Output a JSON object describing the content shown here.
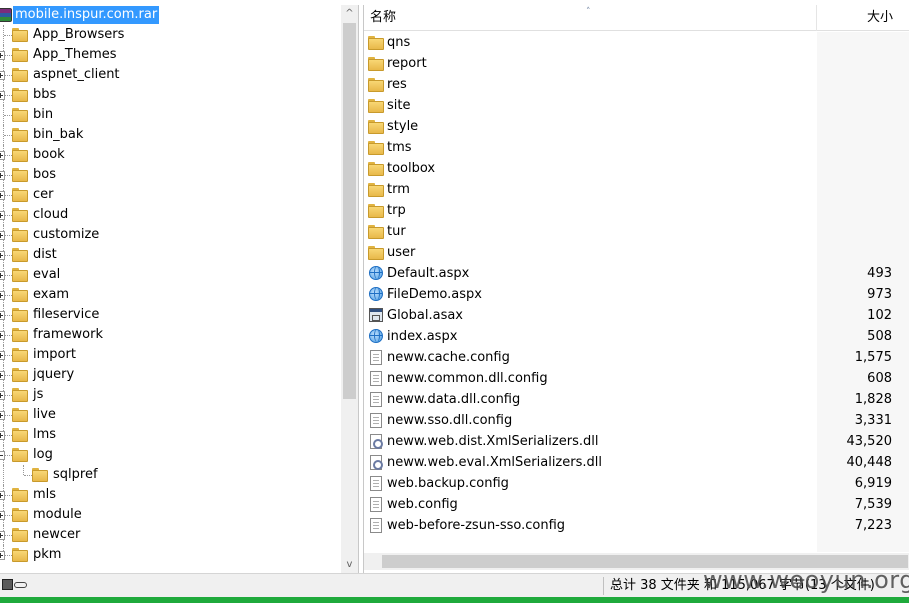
{
  "tree": {
    "root_label": "mobile.inspur.com.rar",
    "items": [
      {
        "label": "App_Browsers",
        "expander": "none",
        "depth": 1
      },
      {
        "label": "App_Themes",
        "expander": "plus",
        "depth": 1
      },
      {
        "label": "aspnet_client",
        "expander": "plus",
        "depth": 1
      },
      {
        "label": "bbs",
        "expander": "plus",
        "depth": 1
      },
      {
        "label": "bin",
        "expander": "none",
        "depth": 1
      },
      {
        "label": "bin_bak",
        "expander": "none",
        "depth": 1
      },
      {
        "label": "book",
        "expander": "plus",
        "depth": 1
      },
      {
        "label": "bos",
        "expander": "plus",
        "depth": 1
      },
      {
        "label": "cer",
        "expander": "plus",
        "depth": 1
      },
      {
        "label": "cloud",
        "expander": "plus",
        "depth": 1
      },
      {
        "label": "customize",
        "expander": "plus",
        "depth": 1
      },
      {
        "label": "dist",
        "expander": "plus",
        "depth": 1
      },
      {
        "label": "eval",
        "expander": "plus",
        "depth": 1
      },
      {
        "label": "exam",
        "expander": "plus",
        "depth": 1
      },
      {
        "label": "fileservice",
        "expander": "plus",
        "depth": 1
      },
      {
        "label": "framework",
        "expander": "plus",
        "depth": 1
      },
      {
        "label": "import",
        "expander": "plus",
        "depth": 1
      },
      {
        "label": "jquery",
        "expander": "plus",
        "depth": 1
      },
      {
        "label": "js",
        "expander": "plus",
        "depth": 1
      },
      {
        "label": "live",
        "expander": "plus",
        "depth": 1
      },
      {
        "label": "lms",
        "expander": "plus",
        "depth": 1
      },
      {
        "label": "log",
        "expander": "minus",
        "depth": 1
      },
      {
        "label": "sqlpref",
        "expander": "none",
        "depth": 2
      },
      {
        "label": "mls",
        "expander": "plus",
        "depth": 1
      },
      {
        "label": "module",
        "expander": "plus",
        "depth": 1
      },
      {
        "label": "newcer",
        "expander": "plus",
        "depth": 1
      },
      {
        "label": "pkm",
        "expander": "plus",
        "depth": 1
      }
    ]
  },
  "list": {
    "columns": {
      "name": "名称",
      "size": "大小"
    },
    "sort_indicator": "˄",
    "rows": [
      {
        "name": "qns",
        "size": "",
        "icon": "folder-icon"
      },
      {
        "name": "report",
        "size": "",
        "icon": "folder-icon"
      },
      {
        "name": "res",
        "size": "",
        "icon": "folder-icon"
      },
      {
        "name": "site",
        "size": "",
        "icon": "folder-icon"
      },
      {
        "name": "style",
        "size": "",
        "icon": "folder-icon"
      },
      {
        "name": "tms",
        "size": "",
        "icon": "folder-icon"
      },
      {
        "name": "toolbox",
        "size": "",
        "icon": "folder-icon"
      },
      {
        "name": "trm",
        "size": "",
        "icon": "folder-icon"
      },
      {
        "name": "trp",
        "size": "",
        "icon": "folder-icon"
      },
      {
        "name": "tur",
        "size": "",
        "icon": "folder-icon"
      },
      {
        "name": "user",
        "size": "",
        "icon": "folder-icon"
      },
      {
        "name": "Default.aspx",
        "size": "493",
        "icon": "globe-icon"
      },
      {
        "name": "FileDemo.aspx",
        "size": "973",
        "icon": "globe-icon"
      },
      {
        "name": "Global.asax",
        "size": "102",
        "icon": "asax-icon"
      },
      {
        "name": "index.aspx",
        "size": "508",
        "icon": "globe-icon"
      },
      {
        "name": "neww.cache.config",
        "size": "1,575",
        "icon": "document-icon"
      },
      {
        "name": "neww.common.dll.config",
        "size": "608",
        "icon": "document-icon"
      },
      {
        "name": "neww.data.dll.config",
        "size": "1,828",
        "icon": "document-icon"
      },
      {
        "name": "neww.sso.dll.config",
        "size": "3,331",
        "icon": "document-icon"
      },
      {
        "name": "neww.web.dist.XmlSerializers.dll",
        "size": "43,520",
        "icon": "dll-icon"
      },
      {
        "name": "neww.web.eval.XmlSerializers.dll",
        "size": "40,448",
        "icon": "dll-icon"
      },
      {
        "name": "web.backup.config",
        "size": "6,919",
        "icon": "document-icon"
      },
      {
        "name": "web.config",
        "size": "7,539",
        "icon": "document-icon"
      },
      {
        "name": "web-before-zsun-sso.config",
        "size": "7,223",
        "icon": "document-icon"
      }
    ]
  },
  "scrollbar": {
    "up_arrow": "^",
    "down_arrow": "v"
  },
  "status": {
    "summary": "总计 38 文件夹 和 115,067 字节(13 个文件)",
    "watermark": "www.wooyun.org"
  },
  "colors": {
    "selection": "#3399ff",
    "accent_bar": "#1faa3c"
  }
}
